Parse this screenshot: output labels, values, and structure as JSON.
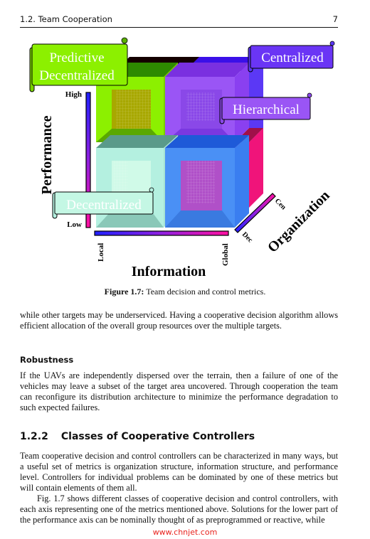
{
  "header": {
    "section": "1.2.  Team Cooperation",
    "page_number": "7"
  },
  "figure": {
    "axes": {
      "performance": {
        "label": "Performance",
        "high": "High",
        "low": "Low"
      },
      "information": {
        "label": "Information",
        "low": "Local",
        "high": "Global"
      },
      "organization": {
        "label": "Organization",
        "low": "Dec",
        "high": "Cen"
      }
    },
    "callouts": {
      "predictive_decentralized": [
        "Predictive",
        "Decentralized"
      ],
      "centralized": "Centralized",
      "hierarchical": "Hierarchical",
      "decentralized": "Decentralized"
    },
    "colors": {
      "predictive_decentralized": "#8cf000",
      "centralized": "#6a35f5",
      "hierarchical": "#9a55f5",
      "decentralized": "#c4f7e4",
      "blue_cube": "#4a90f5",
      "magenta": "#f0147a"
    },
    "caption_label": "Figure 1.7:",
    "caption_text": " Team decision and control metrics."
  },
  "body": {
    "para1": "while other targets may be underserviced. Having a cooperative decision algorithm allows efficient allocation of the overall group resources over the multiple targets.",
    "robustness_heading": "Robustness",
    "para2": "If the UAVs are independently dispersed over the terrain, then a failure of one of the vehicles may leave a subset of the target area uncovered. Through cooperation the team can reconfigure its distribution architecture to minimize the performance degradation to such expected failures.",
    "section_number": "1.2.2",
    "section_title": "Classes of Cooperative Controllers",
    "para3": "Team cooperative decision and control controllers can be characterized in many ways, but a useful set of metrics is organization structure, information structure, and performance level. Controllers for individual problems can be dominated by one of these metrics but will contain elements of them all.",
    "para4": "Fig. 1.7 shows different classes of cooperative decision and control controllers, with each axis representing one of the metrics mentioned above. Solutions for the lower part of the performance axis can be nominally thought of as preprogrammed or reactive, while"
  },
  "watermark": "www.chnjet.com"
}
